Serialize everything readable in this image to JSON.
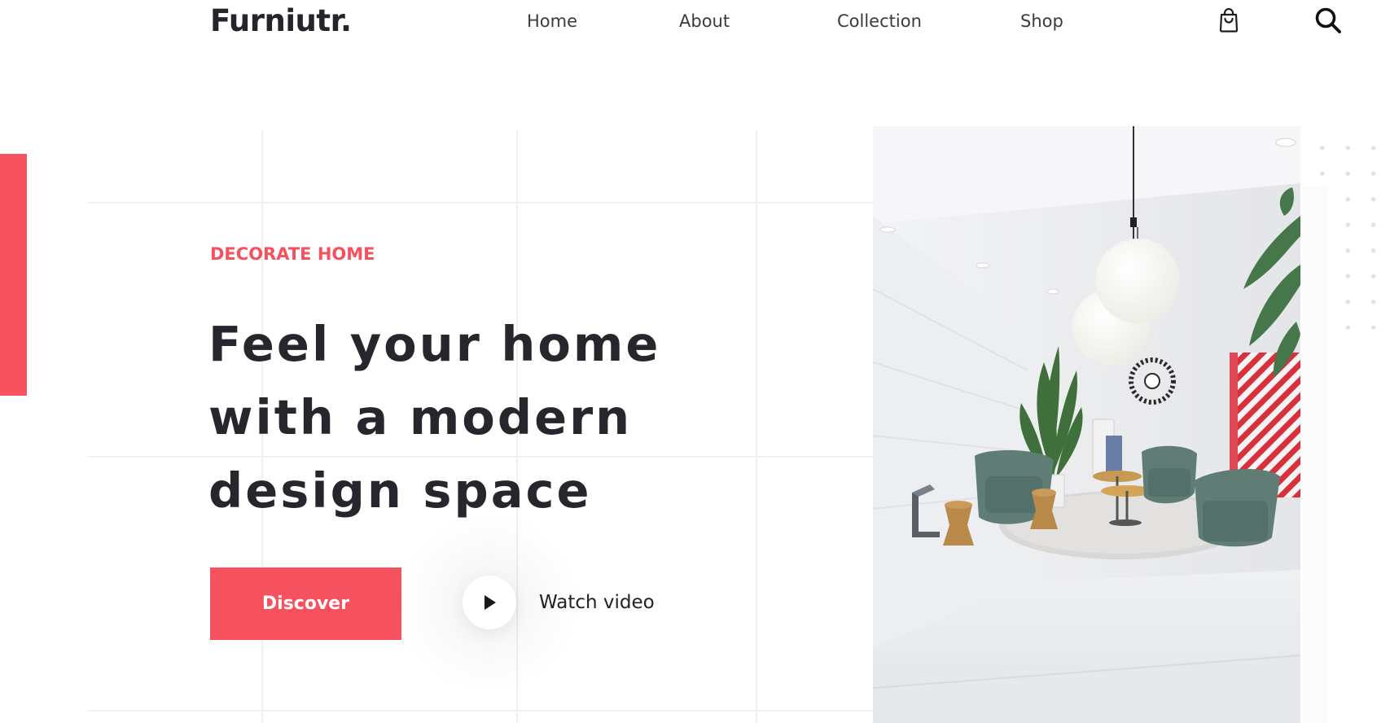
{
  "brand": {
    "logo_text": "Furniutr.",
    "accent_color": "#f5515f"
  },
  "nav": {
    "items": [
      {
        "label": "Home"
      },
      {
        "label": "About"
      },
      {
        "label": "Collection"
      },
      {
        "label": "Shop"
      }
    ],
    "icons": {
      "cart": "shopping-bag-icon",
      "search": "search-icon"
    }
  },
  "hero": {
    "eyebrow": "DECORATE HOME",
    "headline_lines": [
      "Feel your home",
      "with a modern",
      "design space"
    ],
    "primary_cta": "Discover",
    "secondary_cta": "Watch video",
    "image_alt": "Modern living room with green armchairs, paper lantern lamps and plants"
  }
}
